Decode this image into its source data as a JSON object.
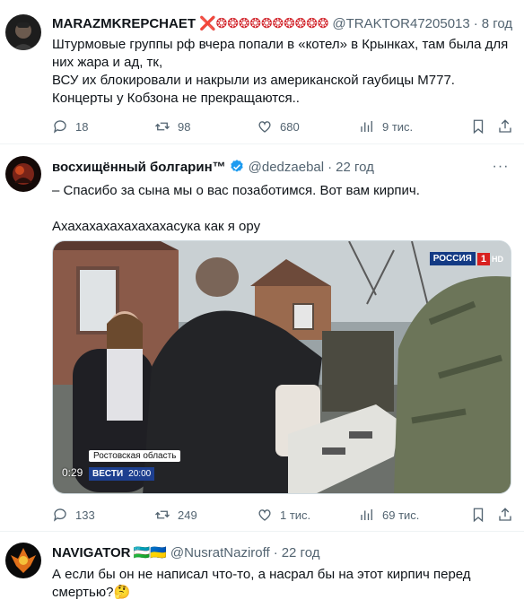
{
  "tweets": [
    {
      "author_name": "MARAZMKREPCHAET",
      "author_extra": "❌❂❂❂❂❂❂❂❂❂❂",
      "handle": "@TRAKTOR47205013",
      "time": "8 год",
      "text": [
        "Штурмовые группы рф вчера попали в «котел» в Крынках, там была для них жара и ад, тк,",
        "ВСУ их блокировали и накрыли из американской гаубицы М777.",
        "Концерты у Кобзона не прекращаются.."
      ],
      "stats": {
        "replies": "18",
        "reposts": "98",
        "likes": "680",
        "views": "9 тис."
      }
    },
    {
      "author_name": "восхищённый болгарин™",
      "verified": true,
      "handle": "@dedzaebal",
      "time": "22 год",
      "text": [
        "– Спасибо за сына мы о вас позаботимся. Вот вам кирпич."
      ],
      "text2": "Ахахахахахахахахасука как я ору",
      "media": {
        "region_caption": "Ростовская область",
        "program": "ВЕСТИ",
        "program_time": "20:00",
        "duration": "0:29",
        "channel": "РОССИЯ",
        "channel_number": "1",
        "channel_hd": "HD"
      },
      "stats": {
        "replies": "133",
        "reposts": "249",
        "likes": "1 тис.",
        "views": "69 тис."
      }
    },
    {
      "author_name": "NAVIGATOR",
      "author_flags": "🇺🇿🇺🇦",
      "handle": "@NusratNaziroff",
      "time": "22 год",
      "text": [
        "А если бы он не написал что-то, а насрал бы на этот кирпич перед смертью?🤔"
      ]
    }
  ],
  "colors": {
    "text": "#0f1419",
    "secondary": "#536471",
    "verified": "#1d9bf0",
    "divider": "#eff3f4"
  },
  "icons": [
    "reply-icon",
    "repost-icon",
    "like-icon",
    "views-icon",
    "bookmark-icon",
    "share-icon",
    "more-icon",
    "verified-badge-icon"
  ]
}
